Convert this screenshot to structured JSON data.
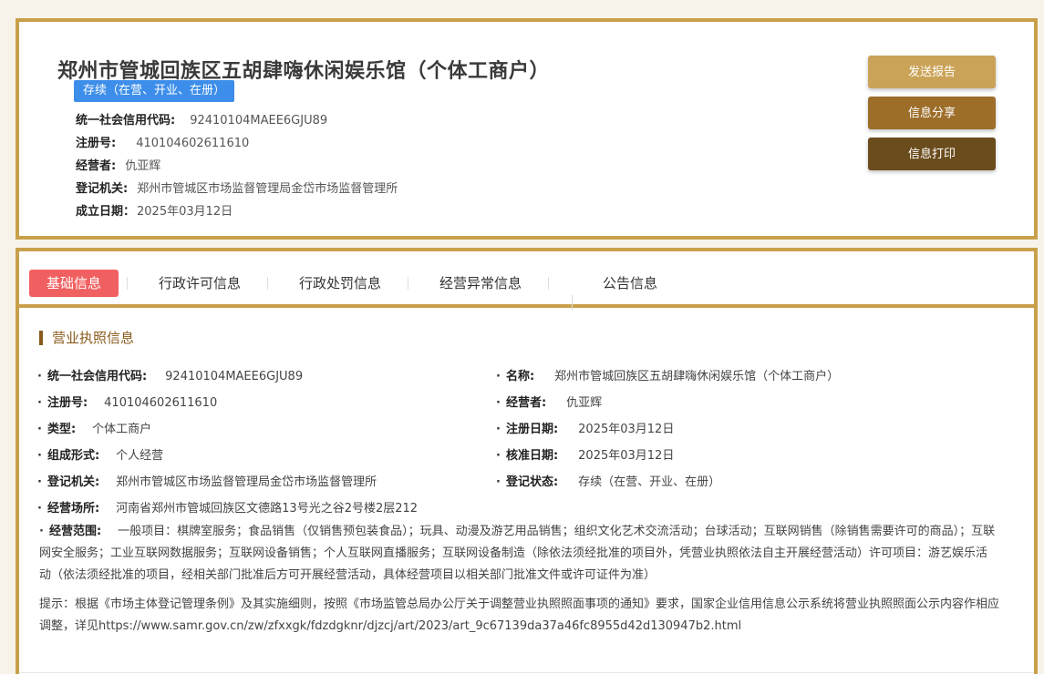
{
  "company": {
    "name": "郑州市管城回族区五胡肆嗨休闲娱乐馆（个体工商户）",
    "status": "存续（在营、开业、在册）",
    "fields": [
      {
        "label": "统一社会信用代码:",
        "value": "92410104MAEE6GJU89"
      },
      {
        "label": "注册号:",
        "value": "410104602611610"
      },
      {
        "label": "经营者:",
        "value": "仇亚辉"
      },
      {
        "label": "登记机关:",
        "value": "郑州市管城区市场监督管理局金岱市场监督管理所"
      },
      {
        "label": "成立日期：",
        "value": "2025年03月12日"
      }
    ]
  },
  "actions": {
    "send": "发送报告",
    "share": "信息分享",
    "print": "信息打印"
  },
  "tabs": [
    "基础信息",
    "行政许可信息",
    "行政处罚信息",
    "经营异常信息",
    "公告信息"
  ],
  "license": {
    "title": "营业执照信息",
    "left": [
      {
        "label": "统一社会信用代码:",
        "value": "92410104MAEE6GJU89"
      },
      {
        "label": "注册号:",
        "value": "410104602611610"
      },
      {
        "label": "类型:",
        "value": "个体工商户"
      },
      {
        "label": "组成形式:",
        "value": "个人经营"
      },
      {
        "label": "登记机关:",
        "value": "郑州市管城区市场监督管理局金岱市场监督管理所"
      },
      {
        "label": "经营场所:",
        "value": "河南省郑州市管城回族区文德路13号光之谷2号楼2层212"
      }
    ],
    "right": [
      {
        "label": "名称:",
        "value": "郑州市管城回族区五胡肆嗨休闲娱乐馆（个体工商户）"
      },
      {
        "label": "经营者:",
        "value": "仇亚辉"
      },
      {
        "label": "注册日期:",
        "value": "2025年03月12日"
      },
      {
        "label": "核准日期:",
        "value": "2025年03月12日"
      },
      {
        "label": "登记状态:",
        "value": "存续（在营、开业、在册）"
      }
    ],
    "scope_label": "经营范围:",
    "scope_value": "一般项目：棋牌室服务；食品销售（仅销售预包装食品）；玩具、动漫及游艺用品销售；组织文化艺术交流活动；台球活动；互联网销售（除销售需要许可的商品）；互联网安全服务；工业互联网数据服务；互联网设备销售；个人互联网直播服务；互联网设备制造（除依法须经批准的项目外，凭营业执照依法自主开展经营活动）许可项目：游艺娱乐活动（依法须经批准的项目，经相关部门批准后方可开展经营活动，具体经营项目以相关部门批准文件或许可证件为准）",
    "notice": "提示：根据《市场主体登记管理条例》及其实施细则，按照《市场监管总局办公厅关于调整营业执照照面事项的通知》要求，国家企业信用信息公示系统将营业执照照面公示内容作相应调整，详见https://www.samr.gov.cn/zw/zfxxgk/fdzdgknr/djzcj/art/2023/art_9c67139da37a46fc8955d42d130947b2.html"
  }
}
